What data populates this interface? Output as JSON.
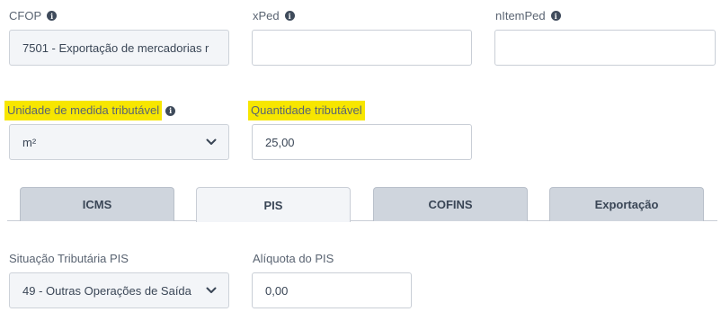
{
  "fields": {
    "cfop": {
      "label": "CFOP",
      "value": "7501 - Exportação de mercadorias r"
    },
    "xped": {
      "label": "xPed",
      "value": ""
    },
    "nitemped": {
      "label": "nItemPed",
      "value": ""
    },
    "unidade": {
      "label": "Unidade de medida tributável",
      "value": "m²",
      "highlighted": true
    },
    "quantidade": {
      "label": "Quantidade tributável",
      "value": "25,00",
      "highlighted": true
    },
    "situacao_pis": {
      "label": "Situação Tributária PIS",
      "value": "49 - Outras Operações de Saída"
    },
    "aliquota_pis": {
      "label": "Alíquota do PIS",
      "value": "0,00"
    }
  },
  "tabs": [
    {
      "label": "ICMS",
      "active": false
    },
    {
      "label": "PIS",
      "active": true
    },
    {
      "label": "COFINS",
      "active": false
    },
    {
      "label": "Exportação",
      "active": false
    }
  ],
  "colors": {
    "highlight": "#f7e600",
    "tab_inactive": "#cfd5dd",
    "tab_active": "#f3f5f8",
    "border": "#c9ced6"
  },
  "icons": {
    "info": "info-icon",
    "dropdown": "chevron-down-icon"
  }
}
